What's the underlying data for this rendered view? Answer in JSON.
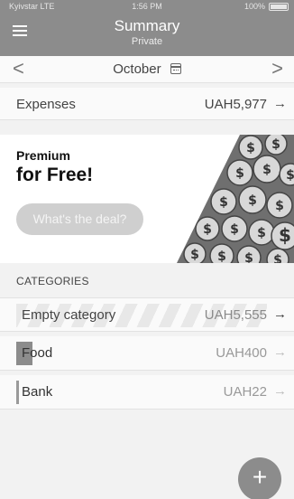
{
  "status_bar": {
    "carrier": "Kyivstar  LTE",
    "time": "1:56 PM",
    "battery": "100%"
  },
  "header": {
    "title": "Summary",
    "subtitle": "Private",
    "menu_icon": "hamburger-menu-icon"
  },
  "month_nav": {
    "prev_label": "<",
    "month": "October",
    "next_label": ">",
    "calendar_icon": "calendar-icon"
  },
  "expenses": {
    "label": "Expenses",
    "amount": "UAH5,977",
    "arrow": "→"
  },
  "promo": {
    "line1": "Premium",
    "line2": "for Free!",
    "cta": "What's the deal?"
  },
  "categories": {
    "header": "CATEGORIES",
    "items": [
      {
        "name": "Empty category",
        "amount": "UAH5,555",
        "arrow": "→"
      },
      {
        "name": "Food",
        "amount": "UAH400",
        "arrow": "→"
      },
      {
        "name": "Bank",
        "amount": "UAH22",
        "arrow": "→"
      }
    ]
  },
  "fab": {
    "label": "+"
  },
  "colors": {
    "header_bg": "#8c8c8c",
    "page_bg": "#f2f2f2",
    "row_bg": "#fafafa"
  }
}
